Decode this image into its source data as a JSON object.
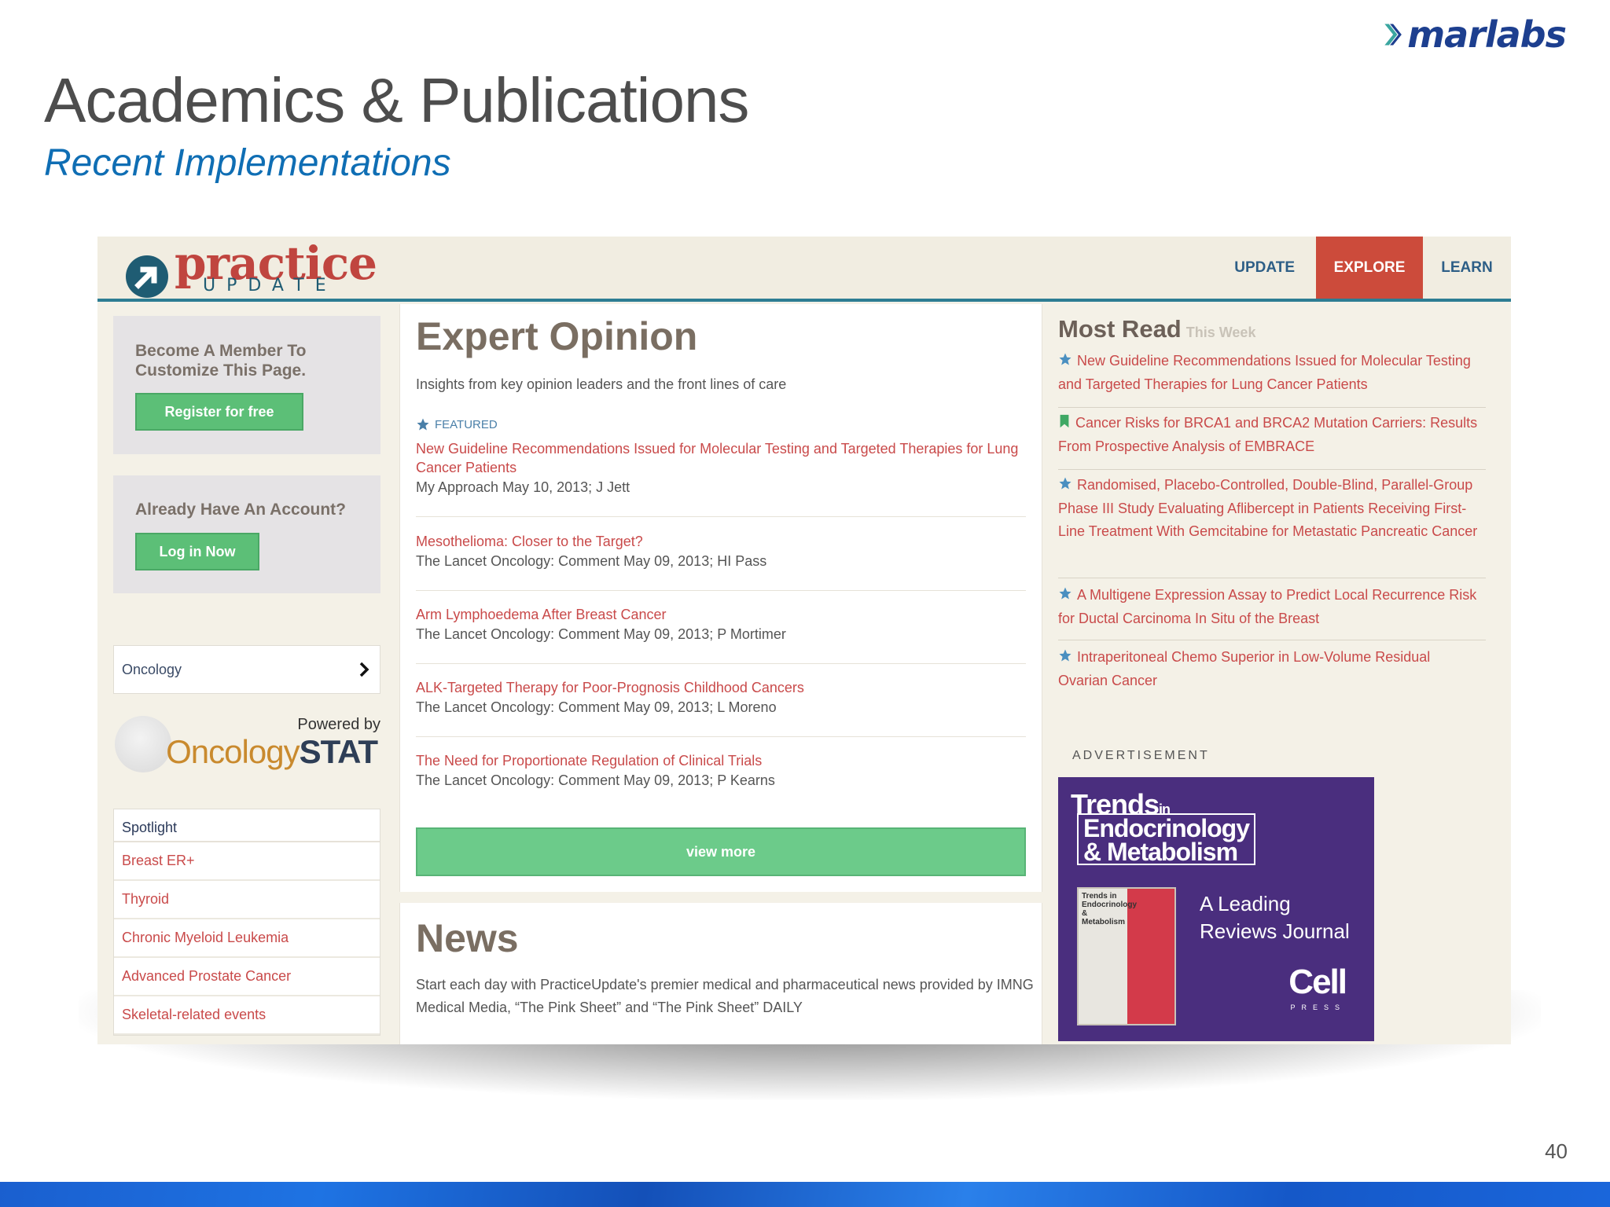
{
  "slide": {
    "logo_text": "marlabs",
    "title": "Academics & Publications",
    "subtitle": "Recent Implementations",
    "page_number": "40"
  },
  "site": {
    "logo_practice": "practice",
    "logo_update": "UPDATE",
    "nav": [
      {
        "label": "UPDATE",
        "active": false
      },
      {
        "label": "EXPLORE",
        "active": true
      },
      {
        "label": "LEARN",
        "active": false
      }
    ]
  },
  "left": {
    "member_text": "Become A Member To Customize This Page.",
    "register_label": "Register for free",
    "account_text": "Already Have An Account?",
    "login_label": "Log in Now",
    "specialty_selected": "Oncology",
    "powered_by": "Powered by",
    "oncologystat_brand": "Oncology",
    "oncologystat_bold": "STAT",
    "spotlight_header": "Spotlight",
    "spotlight_items": [
      "Breast ER+",
      "Thyroid",
      "Chronic Myeloid Leukemia",
      "Advanced Prostate Cancer",
      "Skeletal-related events"
    ]
  },
  "expert": {
    "title": "Expert Opinion",
    "subtitle": "Insights from key opinion leaders and the front lines of care",
    "featured_label": "FEATURED",
    "articles": [
      {
        "title": "New Guideline Recommendations Issued for Molecular Testing and Targeted Therapies for Lung Cancer Patients",
        "meta": "My Approach May 10, 2013; J Jett"
      },
      {
        "title": "Mesothelioma: Closer to the Target?",
        "meta": "The Lancet Oncology: Comment May 09, 2013; HI Pass"
      },
      {
        "title": "Arm Lymphoedema After Breast Cancer",
        "meta": "The Lancet Oncology: Comment May 09, 2013; P Mortimer"
      },
      {
        "title": "ALK-Targeted Therapy for Poor-Prognosis Childhood Cancers",
        "meta": "The Lancet Oncology: Comment May 09, 2013; L Moreno"
      },
      {
        "title": "The Need for Proportionate Regulation of Clinical Trials",
        "meta": "The Lancet Oncology: Comment May 09, 2013; P Kearns"
      }
    ],
    "view_more_label": "view more"
  },
  "news": {
    "title": "News",
    "text": "Start each day with PracticeUpdate's premier medical and pharmaceutical news provided by IMNG Medical Media, “The Pink Sheet” and “The Pink Sheet” DAILY"
  },
  "most_read": {
    "title": "Most Read",
    "period": "This Week",
    "items": [
      {
        "icon": "star-icon",
        "text": "New Guideline Recommendations Issued for Molecular Testing and Targeted Therapies for Lung Cancer Patients"
      },
      {
        "icon": "bookmark-icon",
        "text": "Cancer Risks for BRCA1 and BRCA2 Mutation Carriers: Results From Prospective Analysis of EMBRACE"
      },
      {
        "icon": "star-icon",
        "text": "Randomised, Placebo-Controlled, Double-Blind, Parallel-Group Phase III Study Evaluating Aflibercept in Patients Receiving First-Line Treatment With Gemcitabine for Metastatic Pancreatic Cancer"
      },
      {
        "icon": "star-icon",
        "text": "A Multigene Expression Assay to Predict Local Recurrence Risk for Ductal Carcinoma In Situ of the Breast"
      },
      {
        "icon": "star-icon",
        "text": "Intraperitoneal Chemo Superior in Low-Volume Residual Ovarian Cancer"
      }
    ]
  },
  "ad": {
    "label": "ADVERTISEMENT",
    "brand_trends": "Trends",
    "brand_in": "in",
    "brand_line1": "Endocrinology",
    "brand_line2": "& Metabolism",
    "cover_title": "Trends in Endocrinology & Metabolism",
    "tagline_line1": "A Leading",
    "tagline_line2": "Reviews Journal",
    "publisher": "Cell",
    "publisher_sub": "PRESS"
  },
  "colors": {
    "accent_red": "#c94a4a",
    "nav_active": "#cc4b3b",
    "button_green": "#5cbf77",
    "header_rule": "#2d7d93",
    "slide_title": "#4d4d4d",
    "slide_subtitle": "#0f6eb4"
  }
}
